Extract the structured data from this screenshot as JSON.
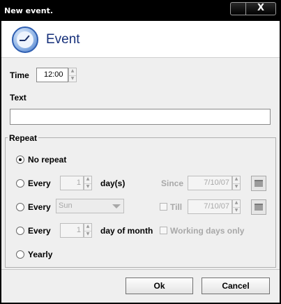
{
  "window": {
    "title": "New event.",
    "close_symbol": "X"
  },
  "banner": {
    "icon": "clock-icon",
    "title": "Event"
  },
  "time": {
    "label": "Time",
    "value": "12:00"
  },
  "text": {
    "label": "Text",
    "value": ""
  },
  "repeat": {
    "label": "Repeat",
    "options": [
      {
        "label": "No repeat",
        "selected": true
      },
      {
        "label": "Every",
        "value": "1",
        "unit": "day(s)",
        "since_label": "Since",
        "since_value": "7/10/07"
      },
      {
        "label": "Every",
        "weekday": "Sun",
        "till_label": "Till",
        "till_value": "7/10/07"
      },
      {
        "label": "Every",
        "value": "1",
        "unit": "day of month",
        "working_days_label": "Working days only"
      },
      {
        "label": "Yearly"
      }
    ]
  },
  "buttons": {
    "ok": "Ok",
    "cancel": "Cancel"
  },
  "colors": {
    "banner_title": "#16307a",
    "titlebar": "#000000",
    "dialog_bg": "#efefef"
  }
}
